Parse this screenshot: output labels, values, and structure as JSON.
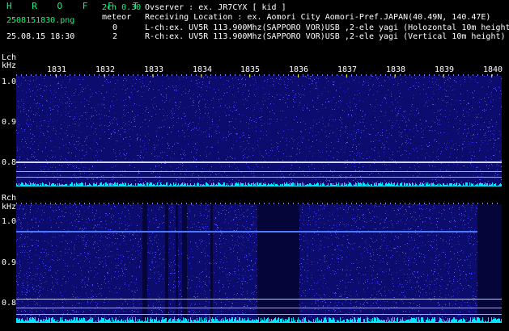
{
  "header": {
    "app_title": "H R O F F T",
    "version": "2ch 0.30",
    "filename": "2508151830.png",
    "meteor_label": "meteor",
    "datetime": "25.08.15 18:30",
    "lch_count": "0",
    "rch_count": "2",
    "observer": "Ovserver           : ex. JR7CYX [ kid ]",
    "location": "Receiving Location : ex. Aomori City Aomori-Pref.JAPAN(40.49N, 140.47E)",
    "lch_info": "L-ch:ex. UV5R 113.900Mhz(SAPPORO VOR)USB ,2-ele yagi (Holozontal 10m height)",
    "rch_info": "R-ch:ex. UV5R 113.900Mhz(SAPPORO VOR)USB ,2-ele yagi (Vertical 10m height)"
  },
  "lch_panel": {
    "channel_label": "Lch",
    "unit_label": "kHz",
    "y_ticks": [
      "1.0",
      "0.9",
      "0.8"
    ],
    "time_ticks": [
      "1831",
      "1832",
      "1833",
      "1834",
      "1835",
      "1836",
      "1837",
      "1838",
      "1839",
      "1840"
    ]
  },
  "rch_panel": {
    "channel_label": "Rch",
    "unit_label": "kHz",
    "y_ticks": [
      "1.0",
      "0.9",
      "0.8"
    ]
  },
  "colors": {
    "title": "#00ff7f",
    "text": "#ffffff",
    "tick_yellow": "#ffff00",
    "noise_blue": "#1a1aa8",
    "level_cyan": "#00e5ff",
    "carrier": "#4a7aff"
  }
}
